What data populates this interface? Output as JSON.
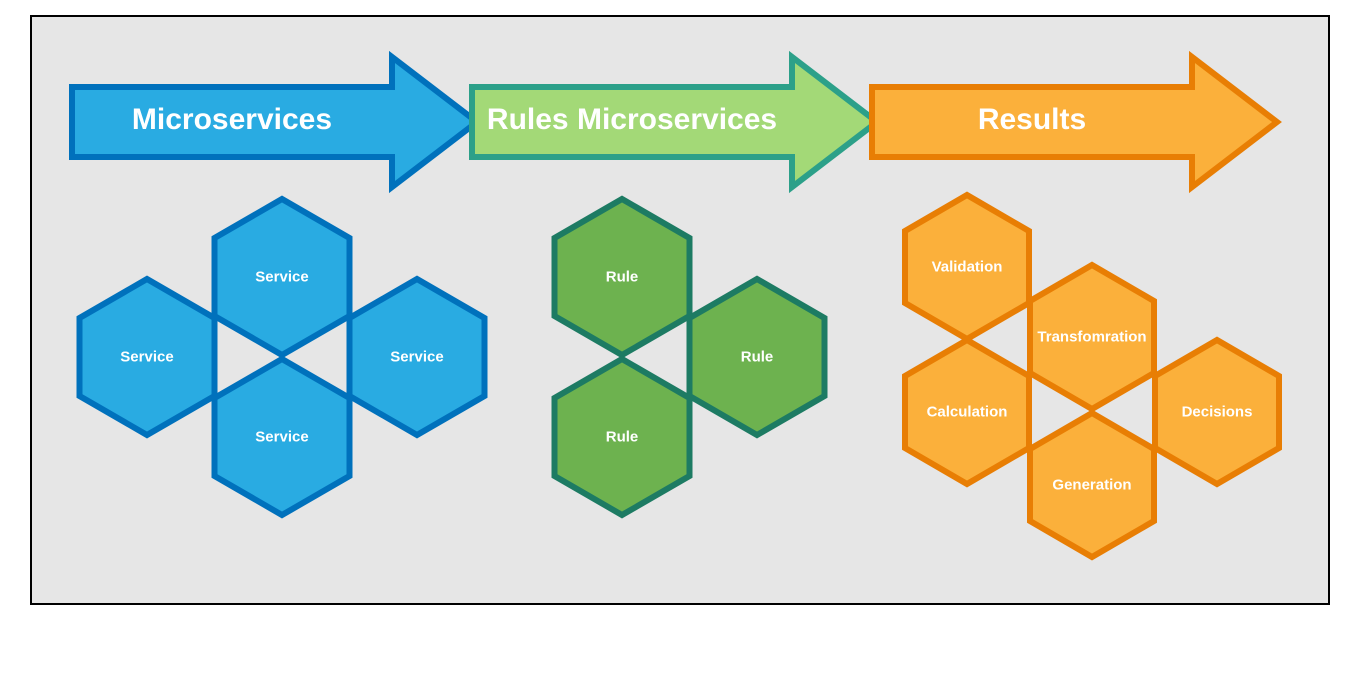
{
  "arrows": {
    "microservices": {
      "label": "Microservices"
    },
    "rules": {
      "label": "Rules Microservices"
    },
    "results": {
      "label": "Results"
    }
  },
  "microservices_hex": {
    "top": "Service",
    "left": "Service",
    "right": "Service",
    "bottom": "Service"
  },
  "rules_hex": {
    "top": "Rule",
    "right": "Rule",
    "bottom": "Rule"
  },
  "results_hex": {
    "r1a": "Validation",
    "r1b": "Transfomration",
    "r2a": "Calculation",
    "r2b": "Decisions",
    "r3a": "Generation"
  },
  "colors": {
    "blue_fill": "#29abe2",
    "blue_stroke": "#0071bc",
    "green_arrow_fill": "#a3d977",
    "green_arrow_stroke": "#2ca089",
    "green_hex_fill": "#6db24f",
    "green_hex_stroke": "#1d7b63",
    "orange_fill": "#fbb03b",
    "orange_stroke": "#e87e04"
  }
}
